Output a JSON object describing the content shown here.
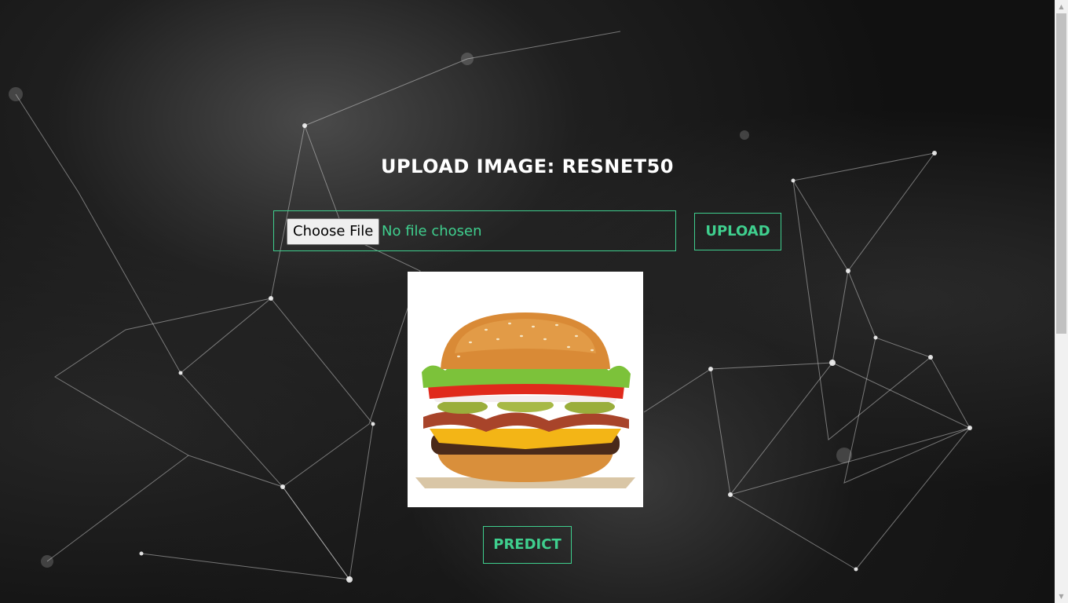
{
  "header": {
    "title": "UPLOAD IMAGE: RESNET50"
  },
  "file_input": {
    "button_label": "Choose File",
    "status_text": "No file chosen"
  },
  "actions": {
    "upload_label": "UPLOAD",
    "predict_label": "PREDICT"
  },
  "preview": {
    "subject": "hamburger"
  },
  "colors": {
    "accent": "#3fcf8e",
    "title_text": "#ffffff",
    "background": "#111111"
  },
  "icons": {
    "scroll_up": "triangle-up",
    "scroll_down": "triangle-down"
  }
}
